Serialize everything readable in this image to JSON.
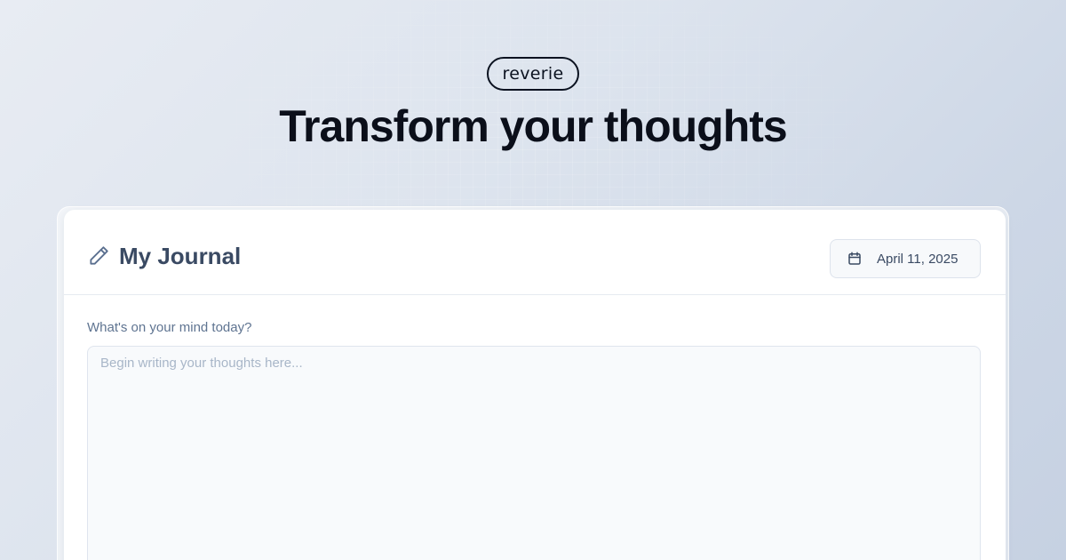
{
  "brand": {
    "name": "reverie"
  },
  "hero": {
    "title": "Transform your thoughts"
  },
  "journal": {
    "title": "My Journal",
    "title_icon": "pencil-icon",
    "date_icon": "calendar-icon",
    "date": "April 11, 2025",
    "prompt_label": "What's on your mind today?",
    "entry_value": "",
    "entry_placeholder": "Begin writing your thoughts here..."
  },
  "colors": {
    "title_text": "#0b0f1a",
    "card_heading": "#3a4a63",
    "label_text": "#5f7491",
    "placeholder_text": "#a8b6c8",
    "background": "#dde4ee"
  }
}
